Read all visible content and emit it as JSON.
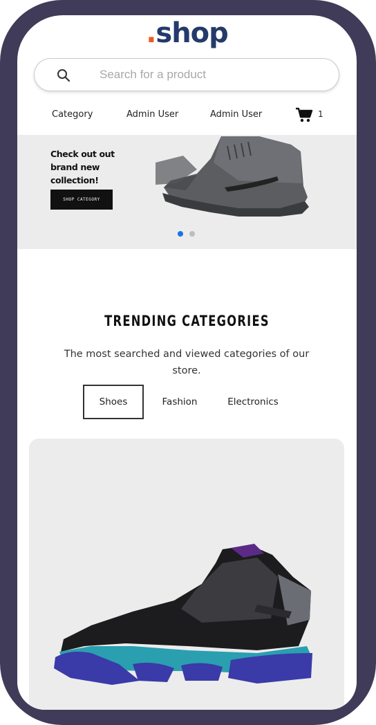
{
  "brand": {
    "logo_dot": ".",
    "logo_text": "shop"
  },
  "search": {
    "placeholder": "Search for a product",
    "icon": "search-icon"
  },
  "nav": {
    "items": [
      "Category",
      "Admin User",
      "Admin User"
    ],
    "cart_icon": "cart-icon",
    "cart_count": "1"
  },
  "banner": {
    "headline": "Check out out brand new collection!",
    "cta_label": "SHOP CATEGORY",
    "carousel": {
      "slides": 2,
      "active": 1
    }
  },
  "trending": {
    "title": "TRENDING CATEGORIES",
    "subtitle": "The most searched and viewed categories of our store.",
    "tabs": [
      {
        "label": "Shoes",
        "active": true
      },
      {
        "label": "Fashion",
        "active": false
      },
      {
        "label": "Electronics",
        "active": false
      }
    ]
  },
  "colors": {
    "frame": "#3f3b58",
    "logo": "#243a6b",
    "logo_dot": "#f05a22",
    "carousel_active": "#1a73e8",
    "carousel_inactive": "#bdbdbd"
  }
}
